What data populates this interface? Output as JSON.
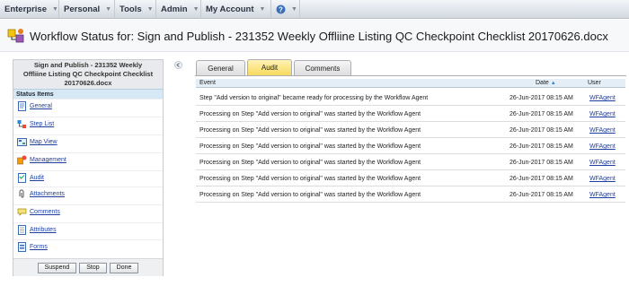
{
  "menu": {
    "items": [
      {
        "label": "Enterprise"
      },
      {
        "label": "Personal"
      },
      {
        "label": "Tools"
      },
      {
        "label": "Admin"
      },
      {
        "label": "My Account"
      },
      {
        "label": ""
      }
    ]
  },
  "header": {
    "title": "Workflow Status for: Sign and Publish - 231352 Weekly Offliine Listing QC Checkpoint Checklist 20170626.docx"
  },
  "sidebar": {
    "header_line1": "Sign and Publish - 231352 Weekly",
    "header_line2": "Offliine Listing QC Checkpoint Checklist",
    "header_line3": "20170626.docx",
    "status_label": "Status Items",
    "items": [
      {
        "label": "General",
        "icon": "document-icon"
      },
      {
        "label": "Step List",
        "icon": "step-list-icon"
      },
      {
        "label": "Map View",
        "icon": "map-icon"
      },
      {
        "label": "Management",
        "icon": "management-icon"
      },
      {
        "label": "Audit",
        "icon": "audit-icon"
      },
      {
        "label": "Attachments",
        "icon": "paperclip-icon"
      },
      {
        "label": "Comments",
        "icon": "comments-icon"
      },
      {
        "label": "Attributes",
        "icon": "attributes-icon"
      },
      {
        "label": "Forms",
        "icon": "forms-icon"
      }
    ],
    "buttons": {
      "suspend": "Suspend",
      "stop": "Stop",
      "done": "Done"
    }
  },
  "tabs": [
    {
      "label": "General",
      "active": false
    },
    {
      "label": "Audit",
      "active": true
    },
    {
      "label": "Comments",
      "active": false
    }
  ],
  "audit": {
    "columns": {
      "event": "Event",
      "date": "Date",
      "user": "User"
    },
    "rows": [
      {
        "event": "Step \"Add version to original\" became ready for processing by the Workflow Agent",
        "date": "26-Jun-2017 08:15 AM",
        "user": "WFAgent"
      },
      {
        "event": "Processing on Step \"Add version to original\" was started by the Workflow Agent",
        "date": "26-Jun-2017 08:15 AM",
        "user": "WFAgent"
      },
      {
        "event": "Processing on Step \"Add version to original\" was started by the Workflow Agent",
        "date": "26-Jun-2017 08:15 AM",
        "user": "WFAgent"
      },
      {
        "event": "Processing on Step \"Add version to original\" was started by the Workflow Agent",
        "date": "26-Jun-2017 08:15 AM",
        "user": "WFAgent"
      },
      {
        "event": "Processing on Step \"Add version to original\" was started by the Workflow Agent",
        "date": "26-Jun-2017 08:15 AM",
        "user": "WFAgent"
      },
      {
        "event": "Processing on Step \"Add version to original\" was started by the Workflow Agent",
        "date": "26-Jun-2017 08:15 AM",
        "user": "WFAgent"
      },
      {
        "event": "Processing on Step \"Add version to original\" was started by the Workflow Agent",
        "date": "26-Jun-2017 08:15 AM",
        "user": "WFAgent"
      }
    ]
  },
  "colors": {
    "accent_tab": "#f7d95d",
    "link": "#1f3fa0",
    "header_blue": "#d6e8f3"
  }
}
